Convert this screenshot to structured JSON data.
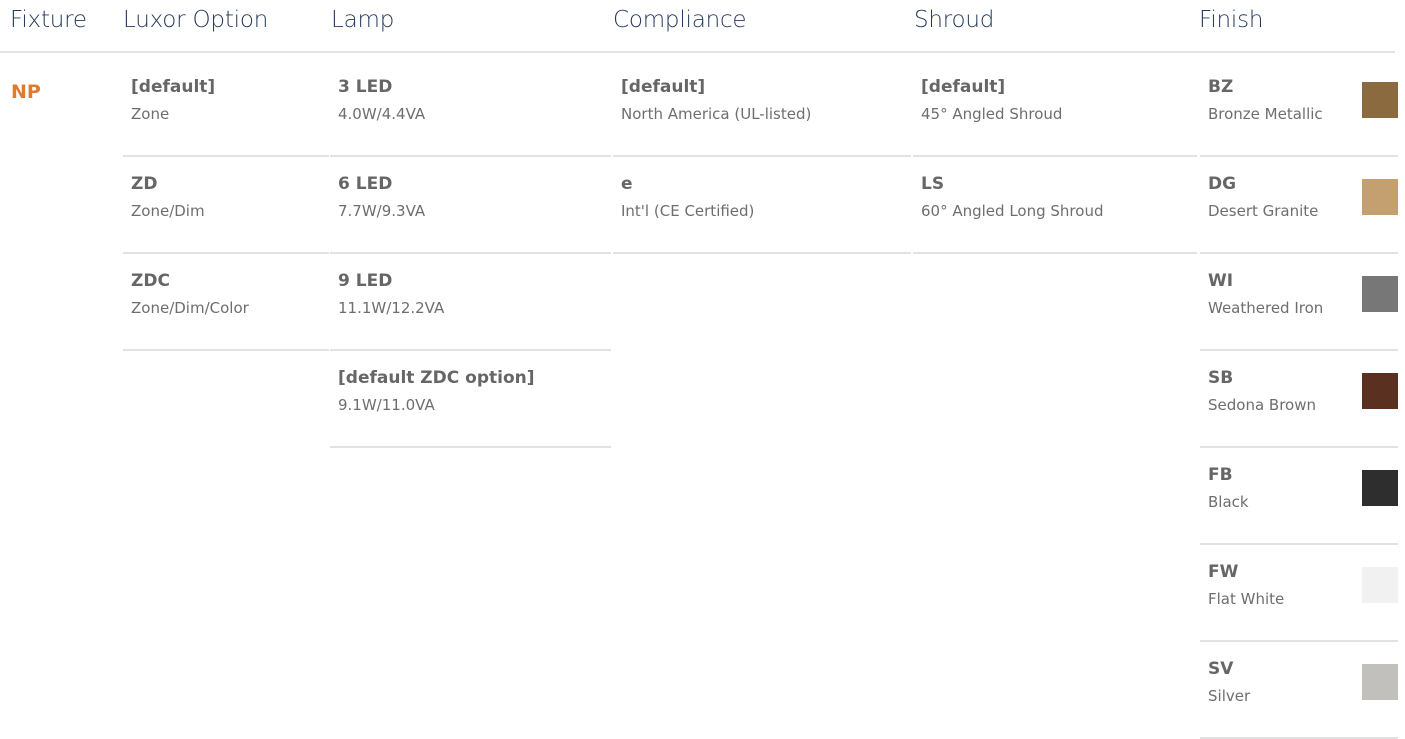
{
  "headers": {
    "fixture": "Fixture",
    "luxor_option": "Luxor Option",
    "lamp": "Lamp",
    "compliance": "Compliance",
    "shroud": "Shroud",
    "finish": "Finish"
  },
  "fixture": {
    "code": "NP"
  },
  "luxor_options": [
    {
      "code": "[default]",
      "desc": "Zone"
    },
    {
      "code": "ZD",
      "desc": "Zone/Dim"
    },
    {
      "code": "ZDC",
      "desc": "Zone/Dim/Color"
    }
  ],
  "lamps": [
    {
      "code": "3 LED",
      "desc": "4.0W/4.4VA"
    },
    {
      "code": "6 LED",
      "desc": "7.7W/9.3VA"
    },
    {
      "code": "9 LED",
      "desc": "11.1W/12.2VA"
    },
    {
      "code": "[default ZDC option]",
      "desc": "9.1W/11.0VA"
    }
  ],
  "compliance": [
    {
      "code": "[default]",
      "desc": "North America (UL-listed)"
    },
    {
      "code": "e",
      "desc": "Int'l (CE Certified)"
    }
  ],
  "shrouds": [
    {
      "code": "[default]",
      "desc": "45° Angled Shroud"
    },
    {
      "code": "LS",
      "desc": "60° Angled Long Shroud"
    }
  ],
  "finishes": [
    {
      "code": "BZ",
      "desc": "Bronze Metallic",
      "color": "#8a6a3e"
    },
    {
      "code": "DG",
      "desc": "Desert Granite",
      "color": "#c4a070"
    },
    {
      "code": "WI",
      "desc": "Weathered Iron",
      "color": "#777777"
    },
    {
      "code": "SB",
      "desc": "Sedona Brown",
      "color": "#5a3020"
    },
    {
      "code": "FB",
      "desc": "Black",
      "color": "#2e2e2e"
    },
    {
      "code": "FW",
      "desc": "Flat White",
      "color": "#f1f1f1"
    },
    {
      "code": "SV",
      "desc": "Silver",
      "color": "#c2c0bd"
    }
  ]
}
